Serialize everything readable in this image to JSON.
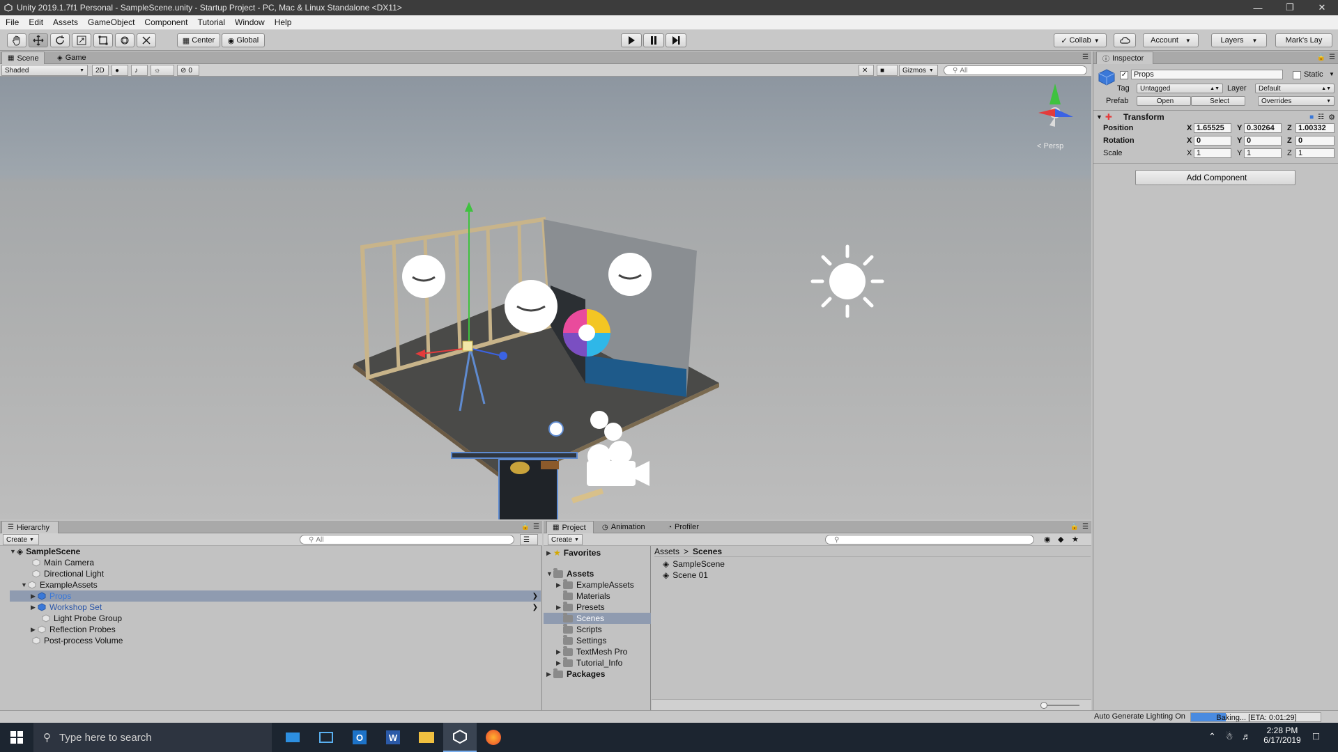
{
  "window": {
    "title": "Unity 2019.1.7f1 Personal - SampleScene.unity - Startup Project - PC, Mac & Linux Standalone <DX11>"
  },
  "menu": [
    "File",
    "Edit",
    "Assets",
    "GameObject",
    "Component",
    "Tutorial",
    "Window",
    "Help"
  ],
  "toolbar": {
    "pivot": "Center",
    "space": "Global",
    "collab": "Collab",
    "account": "Account",
    "layers": "Layers",
    "layout": "Mark's Lay"
  },
  "scene": {
    "tabs": {
      "scene": "Scene",
      "game": "Game"
    },
    "shading": "Shaded",
    "two_d": "2D",
    "fx_count": "0",
    "gizmos": "Gizmos",
    "search_placeholder": "All",
    "persp": "< Persp"
  },
  "hierarchy": {
    "tab": "Hierarchy",
    "create": "Create",
    "search_placeholder": "All",
    "scene_name": "SampleScene",
    "items": [
      {
        "label": "Main Camera"
      },
      {
        "label": "Directional Light"
      },
      {
        "label": "ExampleAssets"
      },
      {
        "label": "Props"
      },
      {
        "label": "Workshop Set"
      },
      {
        "label": "Light Probe Group"
      },
      {
        "label": "Reflection Probes"
      },
      {
        "label": "Post-process Volume"
      }
    ]
  },
  "project": {
    "tabs": {
      "project": "Project",
      "animation": "Animation",
      "profiler": "Profiler"
    },
    "create": "Create",
    "favorites": "Favorites",
    "assets": "Assets",
    "packages": "Packages",
    "folders": [
      "ExampleAssets",
      "Materials",
      "Presets",
      "Scenes",
      "Scripts",
      "Settings",
      "TextMesh Pro",
      "Tutorial_Info"
    ],
    "breadcrumb": {
      "root": "Assets",
      "sep": ">",
      "current": "Scenes"
    },
    "files": [
      "SampleScene",
      "Scene 01"
    ]
  },
  "inspector": {
    "tab": "Inspector",
    "object_name": "Props",
    "static_label": "Static",
    "tag_label": "Tag",
    "tag_value": "Untagged",
    "layer_label": "Layer",
    "layer_value": "Default",
    "prefab_label": "Prefab",
    "prefab_open": "Open",
    "prefab_select": "Select",
    "prefab_overrides": "Overrides",
    "transform_title": "Transform",
    "position_label": "Position",
    "rotation_label": "Rotation",
    "scale_label": "Scale",
    "axis_x": "X",
    "axis_y": "Y",
    "axis_z": "Z",
    "position": {
      "x": "1.65525",
      "y": "0.30264",
      "z": "1.00332"
    },
    "rotation": {
      "x": "0",
      "y": "0",
      "z": "0"
    },
    "scale": {
      "x": "1",
      "y": "1",
      "z": "1"
    },
    "add_component": "Add Component"
  },
  "status": {
    "lighting": "Auto Generate Lighting On",
    "baking": "Baking... [ETA: 0:01:29]",
    "baking_progress": 0.27
  },
  "taskbar": {
    "search_placeholder": "Type here to search",
    "time": "2:28 PM",
    "date": "6/17/2019"
  },
  "colors": {
    "selection": "#8f9bb0",
    "accent_blue": "#3a78d8",
    "baking": "#4a8be0"
  }
}
